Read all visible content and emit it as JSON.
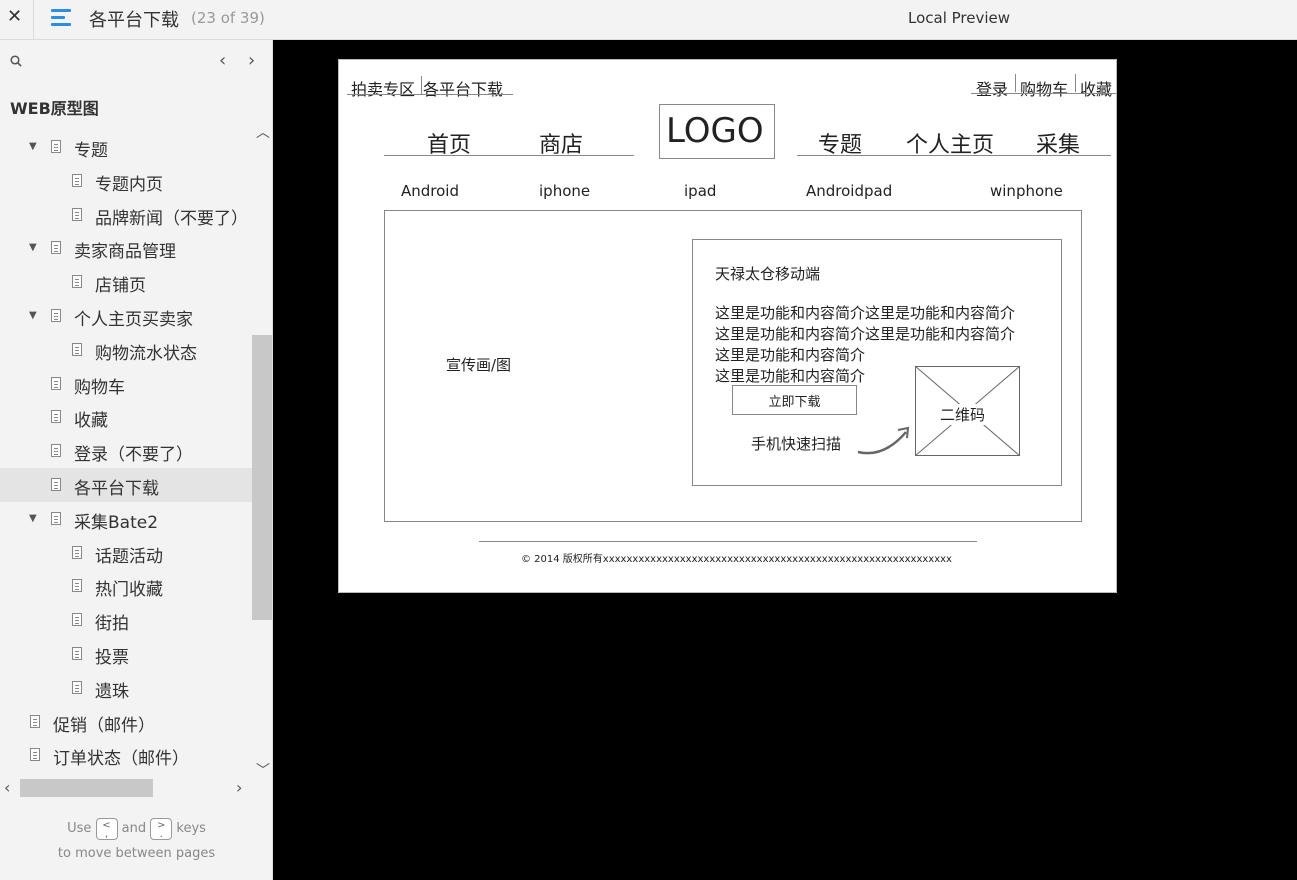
{
  "topbar": {
    "close_glyph": "✕",
    "menu_icon": "hamburger-menu-icon",
    "page_title": "各平台下载",
    "page_count": "(23 of 39)",
    "preview_label": "Local Preview"
  },
  "sidebar": {
    "search_icon": "search-icon",
    "prev_glyph": "‹",
    "next_glyph": "›",
    "project_title": "WEB原型图",
    "items": [
      {
        "label": "专题",
        "expandable": true
      },
      {
        "label": "专题内页",
        "expandable": false
      },
      {
        "label": "品牌新闻（不要了）",
        "expandable": false
      },
      {
        "label": "卖家商品管理",
        "expandable": true
      },
      {
        "label": "店铺页",
        "expandable": false
      },
      {
        "label": "个人主页买卖家",
        "expandable": true
      },
      {
        "label": "购物流水状态",
        "expandable": false
      },
      {
        "label": "购物车",
        "expandable": false
      },
      {
        "label": "收藏",
        "expandable": false
      },
      {
        "label": "登录（不要了）",
        "expandable": false
      },
      {
        "label": "各平台下载",
        "expandable": false,
        "selected": true
      },
      {
        "label": "采集Bate2",
        "expandable": true
      },
      {
        "label": "话题活动",
        "expandable": false
      },
      {
        "label": "热门收藏",
        "expandable": false
      },
      {
        "label": "街拍",
        "expandable": false
      },
      {
        "label": "投票",
        "expandable": false
      },
      {
        "label": "遗珠",
        "expandable": false
      },
      {
        "label": "促销（邮件）",
        "expandable": false
      },
      {
        "label": "订单状态（邮件）",
        "expandable": false
      }
    ],
    "hint": {
      "use": "Use",
      "and": "and",
      "keys": "keys",
      "line2": "to move between pages",
      "prev_key": "<\n,",
      "next_key": ">\n."
    }
  },
  "wireframe": {
    "top_left_links": [
      "拍卖专区",
      "各平台下载"
    ],
    "top_right_links": [
      "登录",
      "购物车",
      "收藏"
    ],
    "nav_left": [
      "首页",
      "商店"
    ],
    "logo": "LOGO",
    "nav_right": [
      "专题",
      "个人主页",
      "采集"
    ],
    "platforms": [
      "Android",
      "iphone",
      "ipad",
      "Androidpad",
      "winphone"
    ],
    "promo_image_label": "宣传画/图",
    "app_title": "天禄太仓移动端",
    "intro_lines": [
      "这里是功能和内容简介这里是功能和内容简介",
      "这里是功能和内容简介这里是功能和内容简介",
      "这里是功能和内容简介",
      "这里是功能和内容简介"
    ],
    "download_button": "立即下载",
    "scan_hint": "手机快速扫描",
    "qr_label": "二维码",
    "footer": "© 2014 版权所有xxxxxxxxxxxxxxxxxxxxxxxxxxxxxxxxxxxxxxxxxxxxxxxxxxxxxxxxxxx"
  }
}
